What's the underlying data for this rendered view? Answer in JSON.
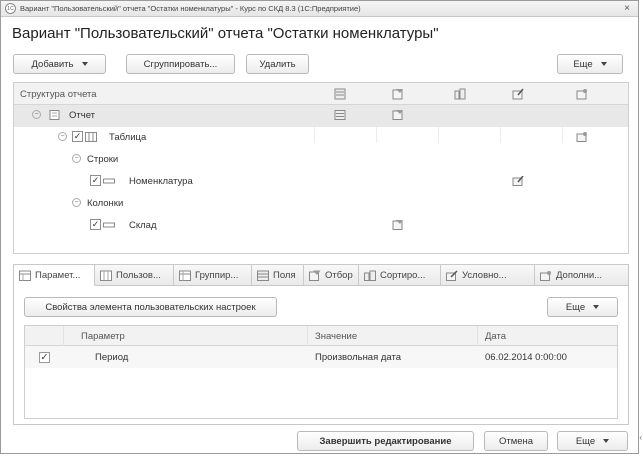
{
  "window": {
    "title": "Вариант \"Пользовательский\" отчета \"Остатки номенклатуры\" - Курс по СКД 8.3  (1С:Предприятие)",
    "app_icon": "1c-icon",
    "close_glyph": "×"
  },
  "heading": "Вариант \"Пользовательский\" отчета \"Остатки номенклатуры\"",
  "toolbar": {
    "add_label": "Добавить",
    "group_label": "Сгруппировать...",
    "delete_label": "Удалить",
    "more_label": "Еще"
  },
  "structure": {
    "header_title": "Структура отчета",
    "column_icons": [
      "fields-icon",
      "filter-icon",
      "group-icon",
      "conditional-icon",
      "other-icon"
    ],
    "rows": {
      "report": "Отчет",
      "table": "Таблица",
      "rows_node": "Строки",
      "nomenclature": "Номенклатура",
      "columns_node": "Колонки",
      "warehouse": "Склад"
    }
  },
  "tabs": [
    {
      "label": "Парамет...",
      "icon": "parameters-icon"
    },
    {
      "label": "Пользов...",
      "icon": "user-fields-icon"
    },
    {
      "label": "Группир...",
      "icon": "grouping-icon"
    },
    {
      "label": "Поля",
      "icon": "fields-icon"
    },
    {
      "label": "Отбор",
      "icon": "filter-icon"
    },
    {
      "label": "Сортиро...",
      "icon": "sort-icon"
    },
    {
      "label": "Условно...",
      "icon": "conditional-icon"
    },
    {
      "label": "Дополни...",
      "icon": "additional-icon"
    }
  ],
  "params_panel": {
    "props_button": "Свойства элемента пользовательских настроек",
    "more_label": "Еще",
    "columns": {
      "param": "Параметр",
      "value": "Значение",
      "date": "Дата"
    },
    "rows": [
      {
        "checked": true,
        "param": "Период",
        "value": "Произвольная дата",
        "date": "06.02.2014 0:00:00"
      }
    ]
  },
  "footer": {
    "finish_label": "Завершить редактирование",
    "cancel_label": "Отмена",
    "more_label": "Еще",
    "edge_char": "‹"
  },
  "colors": {
    "selected_row": "#e8e8e8",
    "panel_header": "#f2f2f2",
    "border": "#c9c9c9"
  }
}
